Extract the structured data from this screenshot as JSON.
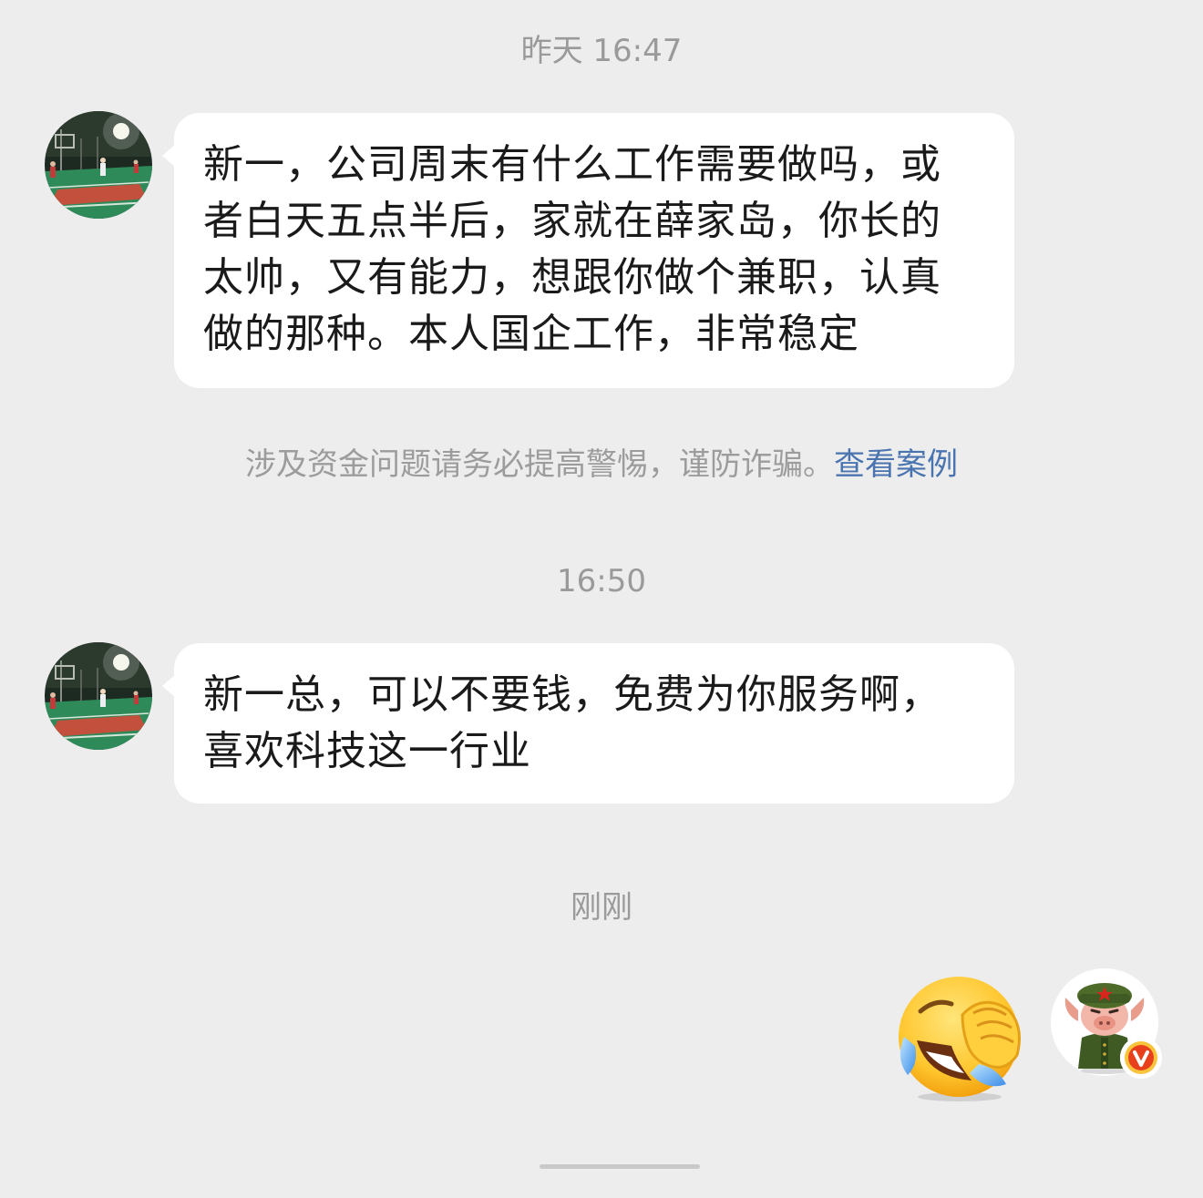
{
  "chat": {
    "timestamps": [
      "昨天 16:47",
      "16:50",
      "刚刚"
    ],
    "messages": [
      {
        "lines": [
          "新一，公司周末有什么工作需要做吗，或",
          "者白天五点半后，家就在薛家岛，你长的",
          "太帅，又有能力，想跟你做个兼职，认真",
          "做的那种。本人国企工作，非常稳定"
        ]
      },
      {
        "lines": [
          "新一总，可以不要钱，免费为你服务啊，",
          "喜欢科技这一行业"
        ]
      }
    ],
    "warning": {
      "text": "涉及资金问题请务必提高警惕，谨防诈骗。",
      "link": "查看案例",
      "link_color": "#4a74b0"
    }
  },
  "icons": {
    "contact_avatar": "basketball-court-photo",
    "reply_sticker": "laughing-crying-emoji",
    "self_avatar": "pig-soldier-cartoon",
    "verified_badge": "v-badge"
  },
  "colors": {
    "background": "#ededed",
    "bubble": "#ffffff",
    "badge": "#e8401c"
  }
}
